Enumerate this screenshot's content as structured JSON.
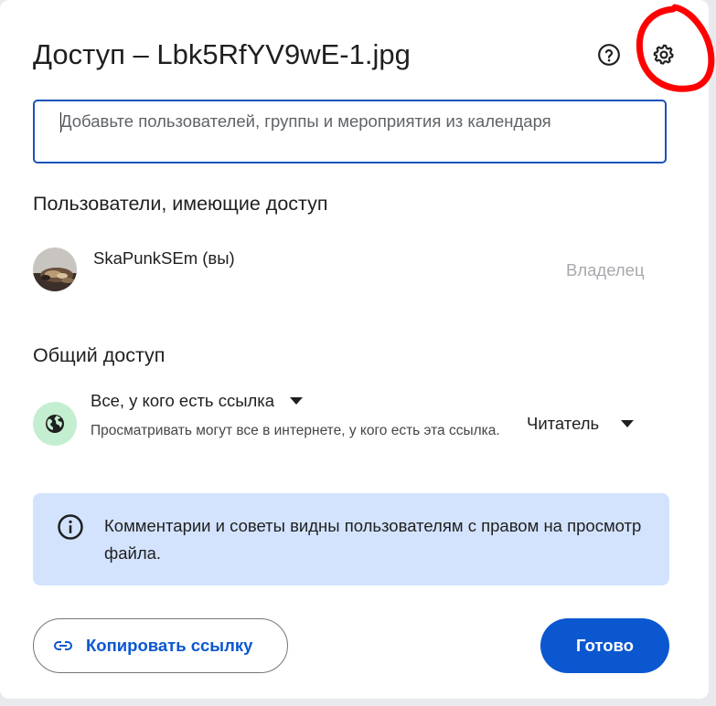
{
  "dialog": {
    "title": "Доступ – Lbk5RfYV9wE-1.jpg",
    "help_icon": "help-circle-icon",
    "settings_icon": "gear-icon"
  },
  "add_people": {
    "placeholder": "Добавьте пользователей, группы и мероприятия из календаря",
    "value": ""
  },
  "people_section": {
    "heading": "Пользователи, имеющие доступ",
    "users": [
      {
        "name": "SkaPunkSEm (вы)",
        "role": "Владелец"
      }
    ]
  },
  "general_access": {
    "heading": "Общий доступ",
    "scope": "Все, у кого есть ссылка",
    "description": "Просматривать могут все в интернете, у кого есть эта ссылка.",
    "role": "Читатель",
    "icon": "globe-icon"
  },
  "info": {
    "icon": "info-icon",
    "text": "Комментарии и советы видны пользователям с правом на просмотр файла."
  },
  "footer": {
    "copy_link_label": "Копировать ссылку",
    "done_label": "Готово"
  },
  "colors": {
    "primary": "#0b57d0",
    "info_bg": "#d3e3fd",
    "globe_bg": "#c4eed0",
    "annotation": "#ff0000"
  }
}
